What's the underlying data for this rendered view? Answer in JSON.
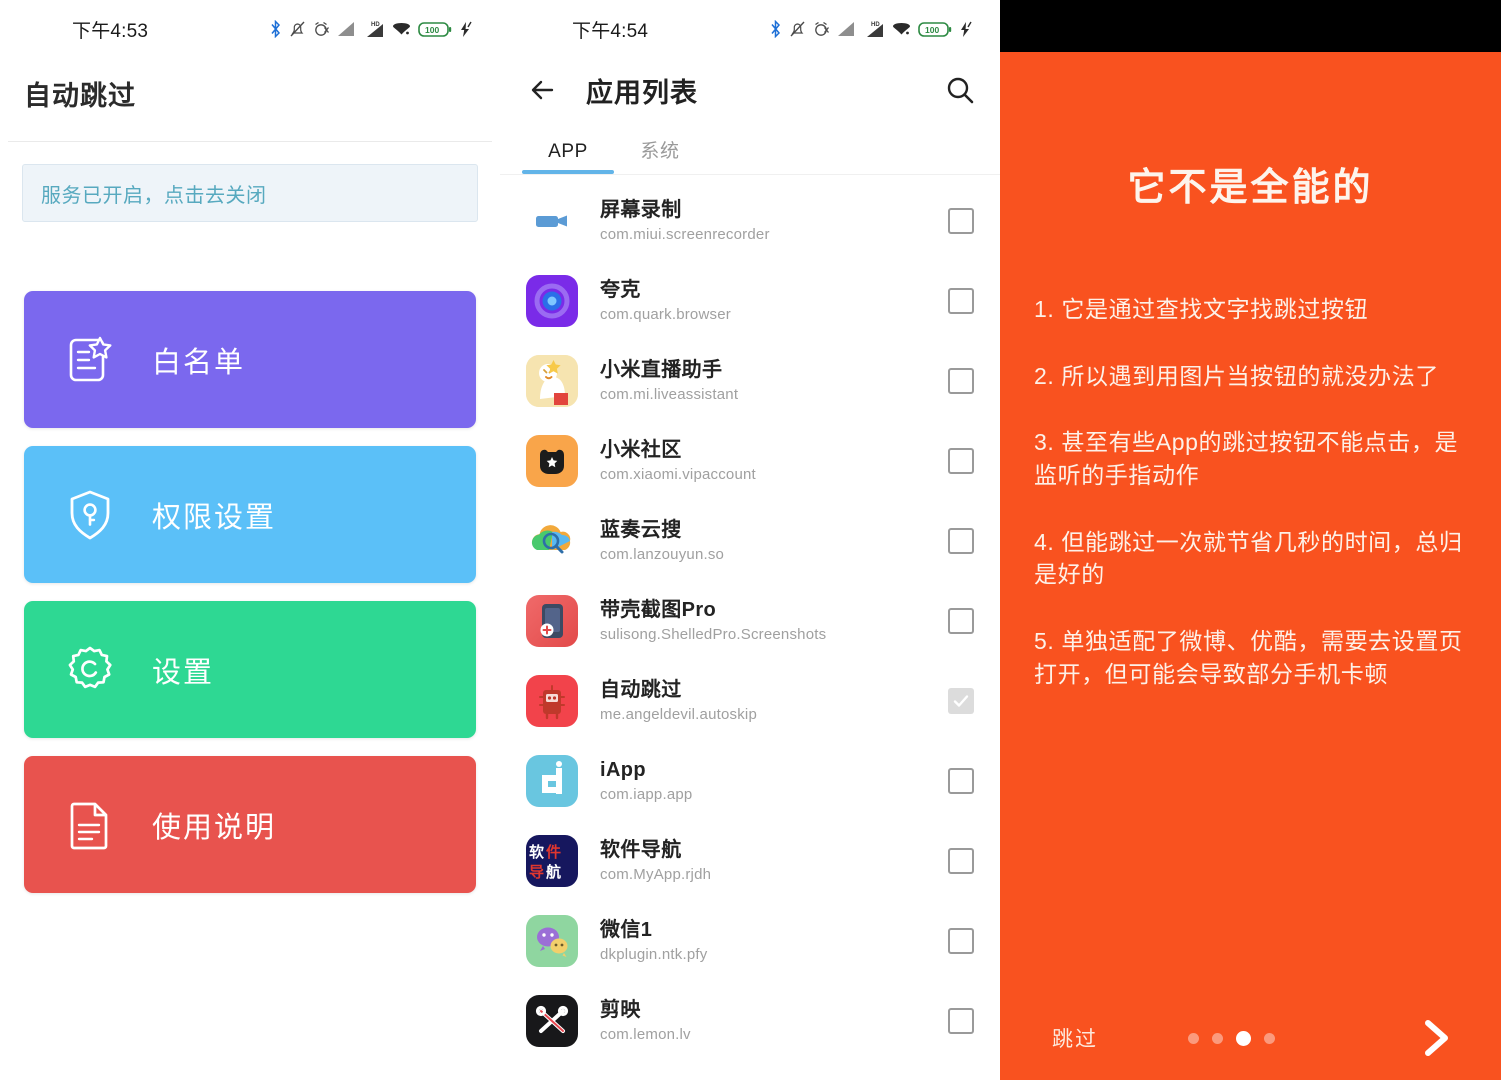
{
  "colors": {
    "whitelist_card": "#7B68EE",
    "permission_card": "#5BC0F8",
    "settings_card": "#2ED893",
    "help_card": "#E8534E",
    "tab_accent": "#62B4E8",
    "banner_text": "#57A9BF",
    "onboarding_bg": "#F9521F"
  },
  "left_panel": {
    "status_bar": {
      "time": "下午4:53",
      "icons": [
        "bluetooth-icon",
        "bell-muted-icon",
        "alarm-off-icon",
        "signal-bars-icon",
        "hd-signal-icon",
        "wifi-icon",
        "battery-icon",
        "charging-bolt-icon"
      ],
      "battery_level": "100"
    },
    "title": "自动跳过",
    "banner": {
      "text": "服务已开启，点击去关闭"
    },
    "cards": [
      {
        "label": "白名单",
        "icon": "list-star-icon",
        "color": "#7B68EE"
      },
      {
        "label": "权限设置",
        "icon": "shield-key-icon",
        "color": "#5BC0F8"
      },
      {
        "label": "设置",
        "icon": "gear-icon",
        "color": "#2ED893"
      },
      {
        "label": "使用说明",
        "icon": "document-icon",
        "color": "#E8534E"
      }
    ]
  },
  "middle_panel": {
    "status_bar": {
      "time": "下午4:54",
      "icons": [
        "bluetooth-icon",
        "bell-muted-icon",
        "alarm-off-icon",
        "signal-bars-icon",
        "hd-signal-icon",
        "wifi-icon",
        "battery-icon",
        "charging-bolt-icon"
      ],
      "battery_level": "100"
    },
    "appbar": {
      "back_icon": "arrow-left-icon",
      "title": "应用列表",
      "search_icon": "search-icon"
    },
    "tabs": [
      {
        "label": "APP",
        "active": true
      },
      {
        "label": "系统",
        "active": false
      }
    ],
    "apps": [
      {
        "name": "屏幕录制",
        "package": "com.miui.screenrecorder",
        "checked": false,
        "icon": "screenrecorder-icon"
      },
      {
        "name": "夸克",
        "package": "com.quark.browser",
        "checked": false,
        "icon": "quark-icon"
      },
      {
        "name": "小米直播助手",
        "package": "com.mi.liveassistant",
        "checked": false,
        "icon": "mi-live-icon"
      },
      {
        "name": "小米社区",
        "package": "com.xiaomi.vipaccount",
        "checked": false,
        "icon": "mi-community-icon"
      },
      {
        "name": "蓝奏云搜",
        "package": "com.lanzouyun.so",
        "checked": false,
        "icon": "lanzou-icon"
      },
      {
        "name": "带壳截图Pro",
        "package": "sulisong.ShelledPro.Screenshots",
        "checked": false,
        "icon": "shelled-icon"
      },
      {
        "name": "自动跳过",
        "package": "me.angeldevil.autoskip",
        "checked": true,
        "icon": "autoskip-icon"
      },
      {
        "name": "iApp",
        "package": "com.iapp.app",
        "checked": false,
        "icon": "iapp-icon"
      },
      {
        "name": "软件导航",
        "package": "com.MyApp.rjdh",
        "checked": false,
        "icon": "rjdh-icon"
      },
      {
        "name": "微信1",
        "package": "dkplugin.ntk.pfy",
        "checked": false,
        "icon": "wechat-icon"
      },
      {
        "name": "剪映",
        "package": "com.lemon.lv",
        "checked": false,
        "icon": "jianying-icon"
      }
    ]
  },
  "right_panel": {
    "headline": "它不是全能的",
    "items": [
      "1. 它是通过查找文字找跳过按钮",
      "2. 所以遇到用图片当按钮的就没办法了",
      "3. 甚至有些App的跳过按钮不能点击，是监听的手指动作",
      "4. 但能跳过一次就节省几秒的时间，总归是好的",
      "5. 单独适配了微博、优酷，需要去设置页打开，但可能会导致部分手机卡顿"
    ],
    "footer": {
      "skip_label": "跳过",
      "next_icon": "chevron-right-icon",
      "dots_total": 4,
      "dots_active_index": 2
    }
  }
}
